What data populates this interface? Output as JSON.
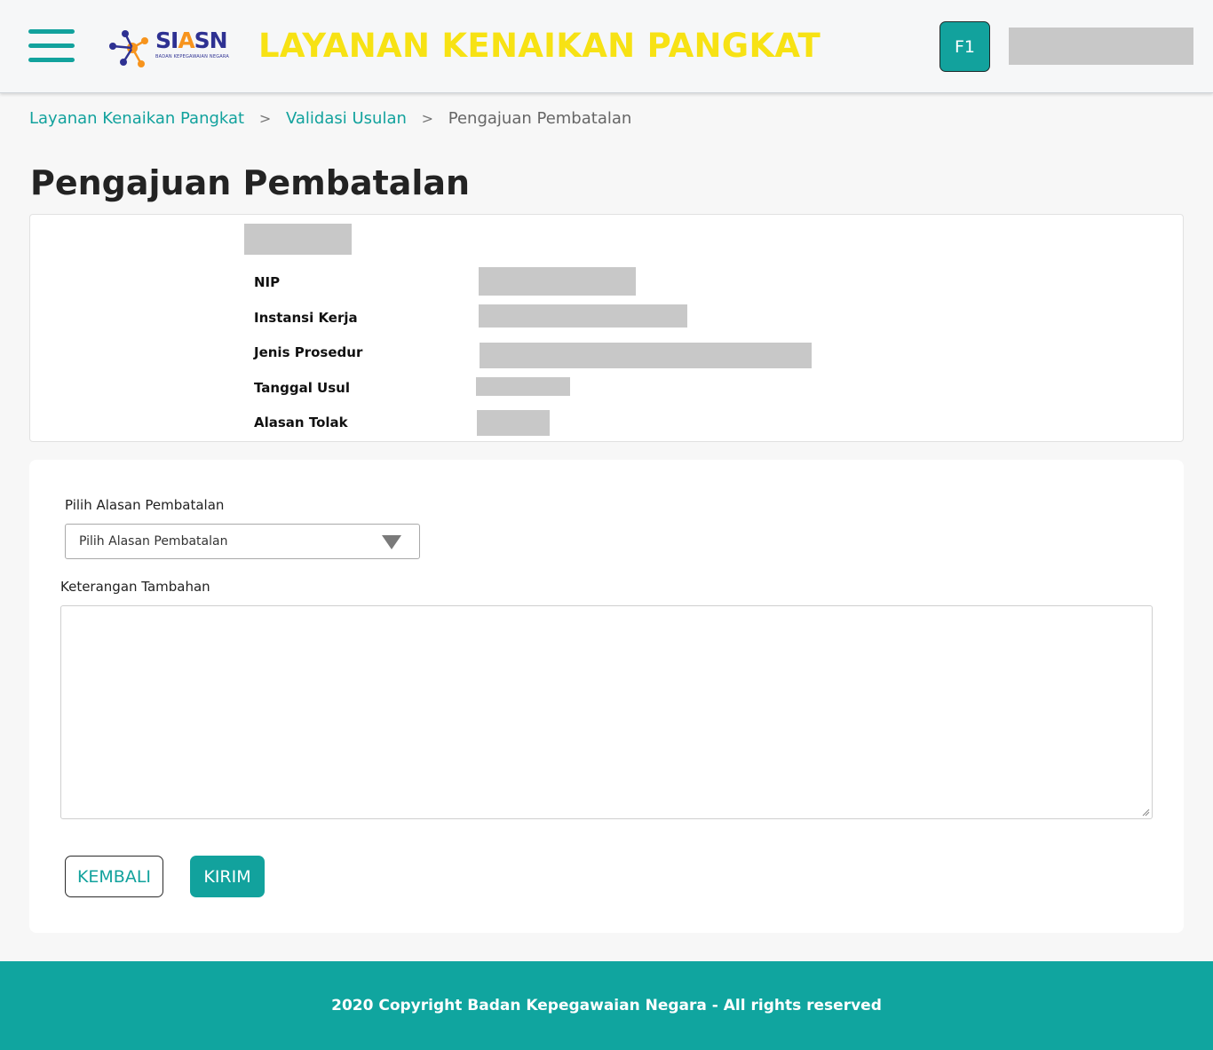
{
  "header": {
    "logo_text_main": "SI",
    "logo_text_accent": "A",
    "logo_text_end": "SN",
    "logo_subtitle": "BADAN KEPEGAWAIAN NEGARA",
    "title": "LAYANAN KENAIKAN PANGKAT",
    "avatar_label": "F1",
    "menu_icon": "hamburger-icon"
  },
  "breadcrumb": {
    "items": [
      "Layanan Kenaikan Pangkat",
      "Validasi Usulan",
      "Pengajuan Pembatalan"
    ],
    "separator": ">"
  },
  "page": {
    "title": "Pengajuan Pembatalan"
  },
  "info": {
    "labels": [
      "NIP",
      "Instansi Kerja",
      "Jenis Prosedur",
      "Tanggal Usul",
      "Alasan Tolak"
    ]
  },
  "form": {
    "reason_label": "Pilih Alasan Pembatalan",
    "reason_selected": "Pilih Alasan Pembatalan",
    "notes_label": "Keterangan Tambahan",
    "notes_value": "",
    "back_button": "KEMBALI",
    "send_button": "KIRIM"
  },
  "footer": {
    "text": "2020 Copyright Badan Kepegawaian Negara - All rights reserved"
  },
  "colors": {
    "primary": "#12a29d",
    "title_yellow": "#f7e214",
    "redacted": "#c8c8c8"
  }
}
